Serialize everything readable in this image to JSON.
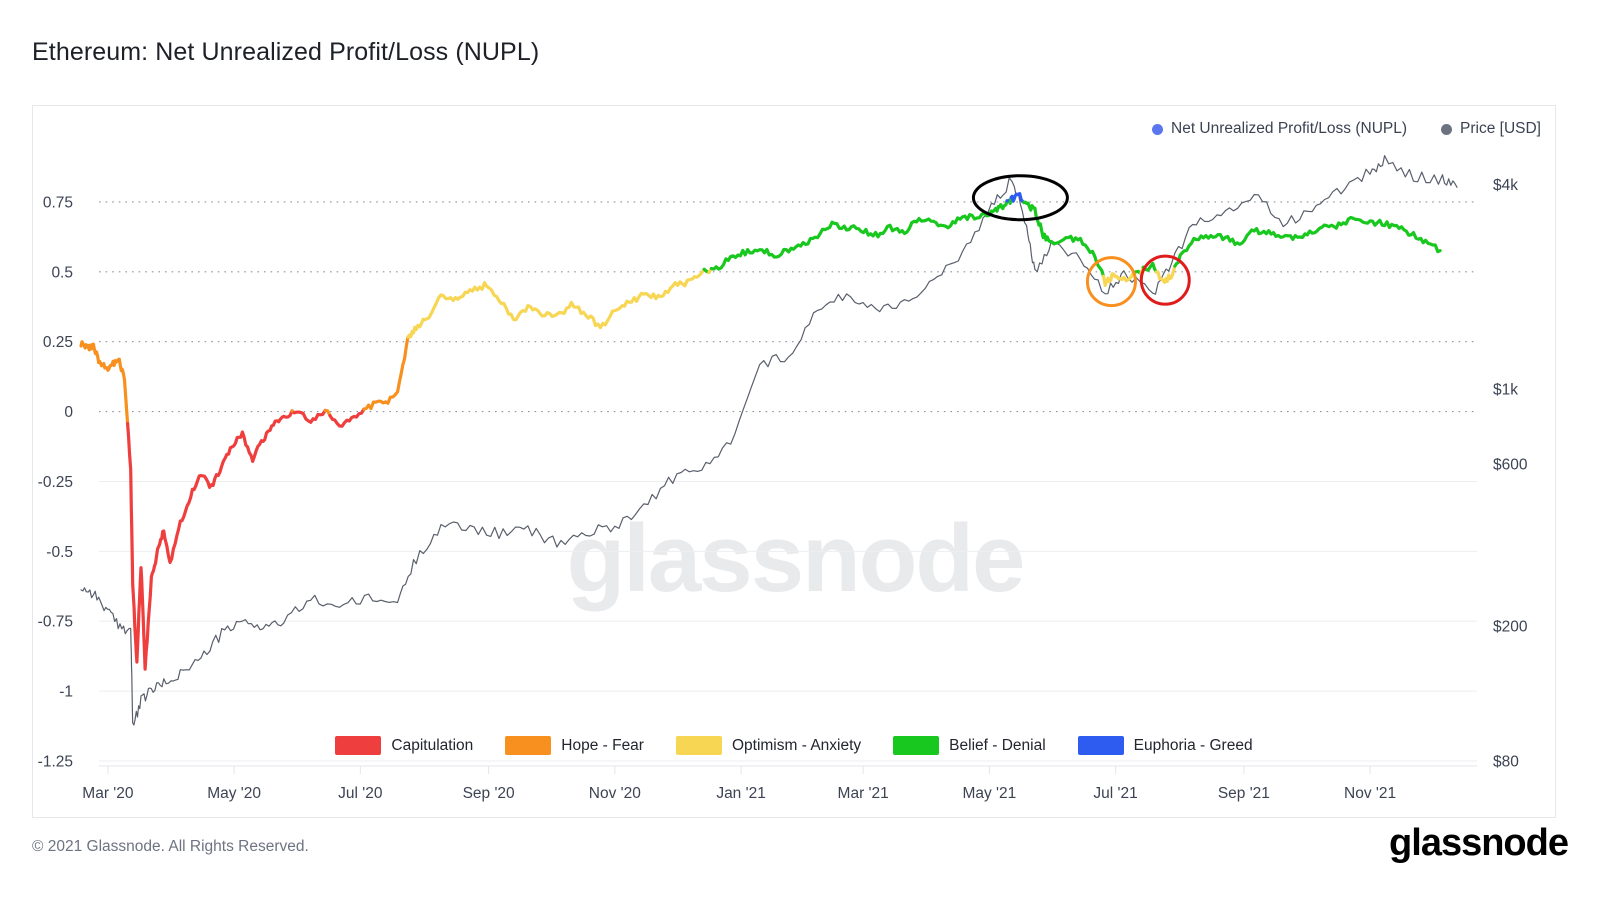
{
  "page_title": "Ethereum: Net Unrealized Profit/Loss (NUPL)",
  "footer": {
    "copyright": "© 2021 Glassnode. All Rights Reserved.",
    "logo": "glassnode"
  },
  "watermark": "glassnode",
  "series_legend": [
    {
      "label": "Net Unrealized Profit/Loss (NUPL)",
      "color": "#5b77ef",
      "icon": "legend-dot-icon"
    },
    {
      "label": "Price [USD]",
      "color": "#6b7280",
      "icon": "legend-dot-icon"
    }
  ],
  "band_legend": [
    {
      "label": "Capitulation",
      "color": "#ef3e3e"
    },
    {
      "label": "Hope - Fear",
      "color": "#f7901e"
    },
    {
      "label": "Optimism - Anxiety",
      "color": "#f7d654"
    },
    {
      "label": "Belief - Denial",
      "color": "#19c81e"
    },
    {
      "label": "Euphoria - Greed",
      "color": "#2f5cf0"
    }
  ],
  "chart_data": {
    "type": "line",
    "title": "Ethereum: Net Unrealized Profit/Loss (NUPL)",
    "xlabel": "",
    "ylabel": "Net Unrealized Profit/Loss (NUPL)",
    "y2label": "Price [USD]",
    "grid": true,
    "legend_position": "top-right",
    "x_ticks": [
      "Mar '20",
      "May '20",
      "Jul '20",
      "Sep '20",
      "Nov '20",
      "Jan '21",
      "Mar '21",
      "May '21",
      "Jul '21",
      "Sep '21",
      "Nov '21"
    ],
    "y_ticks_left": [
      0.75,
      0.5,
      0.25,
      0,
      -0.25,
      -0.5,
      -0.75,
      -1,
      -1.25
    ],
    "ylim_left": [
      -1.25,
      0.95
    ],
    "y_ticks_right": [
      "$4k",
      "$1k",
      "$600",
      "$200",
      "$80"
    ],
    "y_right_values": [
      4000,
      1000,
      600,
      200,
      80
    ],
    "y_right_scale": "log",
    "ylim_right": [
      80,
      5200
    ],
    "bands": [
      {
        "name": "Capitulation",
        "range": [
          -1.25,
          0.0
        ],
        "color": "#ef3e3e"
      },
      {
        "name": "Hope - Fear",
        "range": [
          0.0,
          0.25
        ],
        "color": "#f7901e"
      },
      {
        "name": "Optimism - Anxiety",
        "range": [
          0.25,
          0.5
        ],
        "color": "#f7d654"
      },
      {
        "name": "Belief - Denial",
        "range": [
          0.5,
          0.75
        ],
        "color": "#19c81e"
      },
      {
        "name": "Euphoria - Greed",
        "range": [
          0.75,
          1.0
        ],
        "color": "#2f5cf0"
      }
    ],
    "annotations": [
      {
        "shape": "ellipse",
        "color": "#000000",
        "label": "euphoria-peak-ellipse",
        "x_approx": "May '21",
        "y_approx": 0.78
      },
      {
        "shape": "circle",
        "color": "#f7901e",
        "label": "first-anxiety-dip-circle",
        "x_approx": "late Jun '21",
        "y_approx": 0.46
      },
      {
        "shape": "circle",
        "color": "#e01b1b",
        "label": "second-anxiety-dip-circle",
        "x_approx": "late Jul '21",
        "y_approx": 0.47
      }
    ],
    "series": [
      {
        "name": "Net Unrealized Profit/Loss (NUPL)",
        "color_mode": "banded",
        "x": [
          "2020-02-17",
          "2020-02-20",
          "2020-02-23",
          "2020-02-26",
          "2020-02-29",
          "2020-03-03",
          "2020-03-06",
          "2020-03-09",
          "2020-03-12",
          "2020-03-13",
          "2020-03-15",
          "2020-03-17",
          "2020-03-19",
          "2020-03-22",
          "2020-03-25",
          "2020-03-28",
          "2020-03-31",
          "2020-04-05",
          "2020-04-10",
          "2020-04-15",
          "2020-04-20",
          "2020-04-25",
          "2020-04-30",
          "2020-05-05",
          "2020-05-10",
          "2020-05-15",
          "2020-05-20",
          "2020-05-25",
          "2020-05-31",
          "2020-06-07",
          "2020-06-14",
          "2020-06-21",
          "2020-06-28",
          "2020-07-05",
          "2020-07-12",
          "2020-07-19",
          "2020-07-24",
          "2020-07-28",
          "2020-08-02",
          "2020-08-09",
          "2020-08-16",
          "2020-08-23",
          "2020-08-30",
          "2020-09-06",
          "2020-09-13",
          "2020-09-20",
          "2020-09-27",
          "2020-10-04",
          "2020-10-11",
          "2020-10-18",
          "2020-10-25",
          "2020-11-01",
          "2020-11-08",
          "2020-11-15",
          "2020-11-22",
          "2020-11-29",
          "2020-12-06",
          "2020-12-13",
          "2020-12-20",
          "2020-12-27",
          "2021-01-03",
          "2021-01-10",
          "2021-01-17",
          "2021-01-24",
          "2021-01-31",
          "2021-02-07",
          "2021-02-14",
          "2021-02-21",
          "2021-02-28",
          "2021-03-07",
          "2021-03-14",
          "2021-03-21",
          "2021-03-28",
          "2021-04-04",
          "2021-04-11",
          "2021-04-18",
          "2021-04-25",
          "2021-05-02",
          "2021-05-06",
          "2021-05-09",
          "2021-05-12",
          "2021-05-15",
          "2021-05-19",
          "2021-05-23",
          "2021-05-27",
          "2021-05-31",
          "2021-06-07",
          "2021-06-14",
          "2021-06-21",
          "2021-06-26",
          "2021-06-30",
          "2021-07-05",
          "2021-07-12",
          "2021-07-19",
          "2021-07-24",
          "2021-07-28",
          "2021-08-02",
          "2021-08-09",
          "2021-08-16",
          "2021-08-23",
          "2021-08-30",
          "2021-09-06",
          "2021-09-13",
          "2021-09-20",
          "2021-09-27",
          "2021-10-04",
          "2021-10-11",
          "2021-10-18",
          "2021-10-25",
          "2021-11-01",
          "2021-11-08",
          "2021-11-15",
          "2021-11-22",
          "2021-11-29",
          "2021-12-06",
          "2021-12-13"
        ],
        "y": [
          0.245,
          0.225,
          0.235,
          0.175,
          0.155,
          0.165,
          0.19,
          0.12,
          -0.2,
          -0.62,
          -0.9,
          -0.55,
          -0.92,
          -0.6,
          -0.5,
          -0.42,
          -0.55,
          -0.4,
          -0.3,
          -0.22,
          -0.27,
          -0.2,
          -0.12,
          -0.08,
          -0.17,
          -0.1,
          -0.04,
          -0.02,
          0.0,
          -0.03,
          0.0,
          -0.05,
          -0.02,
          0.02,
          0.03,
          0.06,
          0.26,
          0.3,
          0.33,
          0.42,
          0.4,
          0.43,
          0.45,
          0.4,
          0.33,
          0.37,
          0.35,
          0.34,
          0.38,
          0.35,
          0.3,
          0.36,
          0.39,
          0.42,
          0.41,
          0.45,
          0.46,
          0.5,
          0.51,
          0.55,
          0.57,
          0.58,
          0.56,
          0.58,
          0.6,
          0.63,
          0.67,
          0.66,
          0.65,
          0.63,
          0.66,
          0.64,
          0.69,
          0.68,
          0.66,
          0.7,
          0.69,
          0.71,
          0.73,
          0.74,
          0.76,
          0.78,
          0.74,
          0.72,
          0.63,
          0.6,
          0.62,
          0.61,
          0.56,
          0.46,
          0.49,
          0.47,
          0.5,
          0.52,
          0.46,
          0.49,
          0.57,
          0.62,
          0.63,
          0.62,
          0.6,
          0.65,
          0.64,
          0.62,
          0.63,
          0.64,
          0.66,
          0.67,
          0.69,
          0.68,
          0.67,
          0.66,
          0.63,
          0.6,
          0.57
        ]
      },
      {
        "name": "Price [USD]",
        "color": "#595f6b",
        "x": [
          "2020-02-17",
          "2020-02-23",
          "2020-02-29",
          "2020-03-06",
          "2020-03-12",
          "2020-03-13",
          "2020-03-17",
          "2020-03-22",
          "2020-03-28",
          "2020-04-05",
          "2020-04-15",
          "2020-04-25",
          "2020-05-05",
          "2020-05-15",
          "2020-05-25",
          "2020-06-07",
          "2020-06-21",
          "2020-07-05",
          "2020-07-19",
          "2020-07-28",
          "2020-08-09",
          "2020-08-23",
          "2020-09-06",
          "2020-09-20",
          "2020-10-04",
          "2020-10-18",
          "2020-11-01",
          "2020-11-15",
          "2020-11-29",
          "2020-12-13",
          "2020-12-27",
          "2021-01-10",
          "2021-01-24",
          "2021-02-07",
          "2021-02-21",
          "2021-03-07",
          "2021-03-21",
          "2021-04-04",
          "2021-04-18",
          "2021-05-02",
          "2021-05-12",
          "2021-05-19",
          "2021-05-23",
          "2021-05-31",
          "2021-06-14",
          "2021-06-26",
          "2021-07-05",
          "2021-07-19",
          "2021-07-28",
          "2021-08-09",
          "2021-08-23",
          "2021-09-06",
          "2021-09-20",
          "2021-10-04",
          "2021-10-18",
          "2021-11-01",
          "2021-11-08",
          "2021-11-22",
          "2021-12-06",
          "2021-12-13"
        ],
        "y": [
          260,
          250,
          225,
          200,
          195,
          100,
          120,
          130,
          135,
          145,
          160,
          190,
          205,
          200,
          205,
          240,
          230,
          240,
          235,
          315,
          395,
          390,
          375,
          385,
          350,
          375,
          395,
          450,
          545,
          580,
          690,
          1180,
          1250,
          1700,
          1900,
          1720,
          1800,
          2080,
          2450,
          3450,
          4150,
          3050,
          2200,
          2700,
          2450,
          1900,
          2180,
          1900,
          2350,
          3150,
          3250,
          3750,
          3050,
          3400,
          3850,
          4350,
          4700,
          4250,
          4150,
          3900
        ]
      }
    ]
  }
}
